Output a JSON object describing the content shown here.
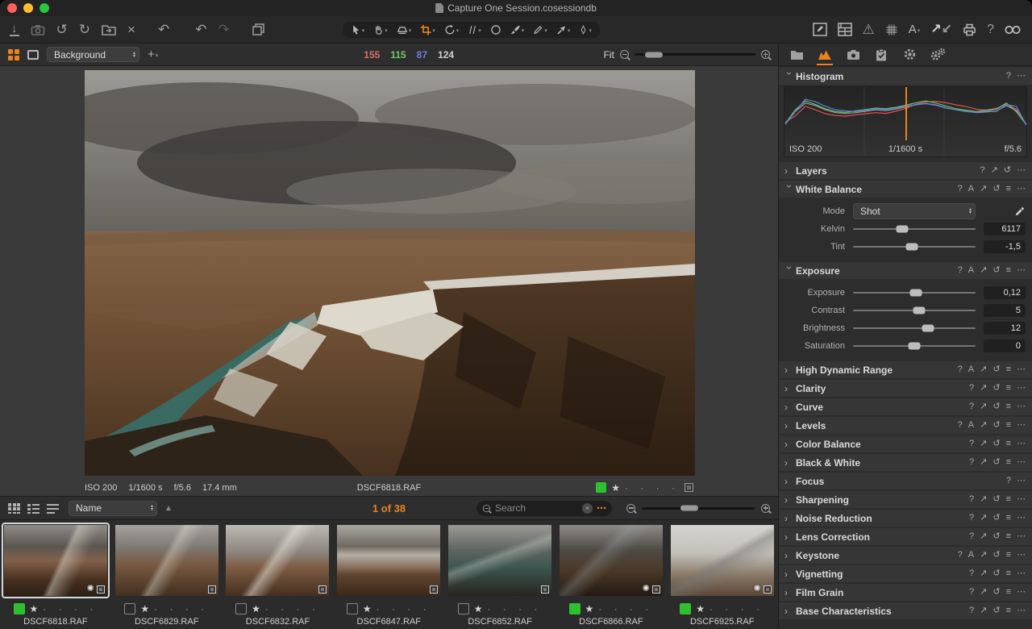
{
  "window": {
    "title": "Capture One Session.cosessiondb"
  },
  "colors": {
    "accent_orange": "#e8831d",
    "tag_green": "#2fc02f",
    "traffic_red": "#ff5f57",
    "traffic_yellow": "#febc2e",
    "traffic_green": "#28c840",
    "rgb_r": "#e06c6c",
    "rgb_g": "#6cc86c",
    "rgb_b": "#7a7ae8",
    "rgb_l": "#d0d0d0"
  },
  "icons": {
    "help": "?",
    "auto": "A",
    "copy": "↗",
    "reset": "↺",
    "presets": "≡",
    "more": "⋯",
    "chev_right": "›",
    "caret": "▾",
    "sort_asc": "▲",
    "star": "★",
    "dots": "· · · ·",
    "plus": "+",
    "close": "×",
    "undo": "↶",
    "redo": "↷",
    "rotate_ccw": "↺",
    "rotate_cw": "↻",
    "import": "↓",
    "warning": "⚠",
    "glasses": "OO",
    "annotation": "A",
    "export_up": "↗",
    "export_down": "↙",
    "gear_overlay": "✺"
  },
  "viewer_bar": {
    "layer_select": "Background",
    "rgb": {
      "r": "155",
      "g": "115",
      "b": "87",
      "l": "124"
    },
    "fit_label": "Fit"
  },
  "viewer_info": {
    "iso": "ISO 200",
    "shutter": "1/1600 s",
    "aperture": "f/5.6",
    "focal": "17.4 mm",
    "filename": "DSCF6818.RAF",
    "tag": "green",
    "rating": 1
  },
  "browser": {
    "sort_label": "Name",
    "count": "1 of 38",
    "search_placeholder": "Search",
    "more_label": "⋯"
  },
  "panels": {
    "histogram": {
      "title": "Histogram",
      "iso": "ISO 200",
      "shutter": "1/1600 s",
      "aperture": "f/5.6",
      "curves": {
        "r": [
          10,
          28,
          55,
          45,
          34,
          29,
          27,
          31,
          34,
          37,
          35,
          41,
          49,
          61,
          67,
          69,
          65,
          59,
          54,
          47,
          44,
          49,
          61,
          47,
          4
        ],
        "g": [
          6,
          45,
          70,
          60,
          48,
          40,
          38,
          42,
          46,
          50,
          48,
          52,
          58,
          65,
          70,
          64,
          56,
          48,
          44,
          40,
          44,
          46,
          64,
          40,
          3
        ],
        "b": [
          4,
          40,
          75,
          68,
          55,
          45,
          42,
          40,
          44,
          48,
          46,
          50,
          55,
          60,
          62,
          58,
          50,
          45,
          40,
          38,
          42,
          40,
          60,
          55,
          2
        ],
        "l": [
          5,
          40,
          64,
          57,
          45,
          37,
          35,
          37,
          41,
          45,
          43,
          47,
          53,
          59,
          63,
          59,
          51,
          45,
          41,
          37,
          39,
          41,
          57,
          43,
          3
        ]
      }
    },
    "layers": {
      "title": "Layers"
    },
    "white_balance": {
      "title": "White Balance",
      "mode_label": "Mode",
      "mode_value": "Shot",
      "kelvin_label": "Kelvin",
      "kelvin_value": "6117",
      "tint_label": "Tint",
      "tint_value": "-1,5"
    },
    "exposure": {
      "title": "Exposure",
      "sliders": [
        {
          "label": "Exposure",
          "value": "0,12"
        },
        {
          "label": "Contrast",
          "value": "5"
        },
        {
          "label": "Brightness",
          "value": "12"
        },
        {
          "label": "Saturation",
          "value": "0"
        }
      ]
    },
    "collapsed": [
      {
        "title": "High Dynamic Range",
        "auto": true
      },
      {
        "title": "Clarity",
        "auto": false
      },
      {
        "title": "Curve",
        "auto": false
      },
      {
        "title": "Levels",
        "auto": true
      },
      {
        "title": "Color Balance",
        "auto": false
      },
      {
        "title": "Black & White",
        "auto": false
      },
      {
        "title": "Focus",
        "auto": false,
        "minimal": true
      },
      {
        "title": "Sharpening",
        "auto": false
      },
      {
        "title": "Noise Reduction",
        "auto": false
      },
      {
        "title": "Lens Correction",
        "auto": false
      },
      {
        "title": "Keystone",
        "auto": true
      },
      {
        "title": "Vignetting",
        "auto": false
      },
      {
        "title": "Film Grain",
        "auto": false
      },
      {
        "title": "Base Characteristics",
        "auto": false
      }
    ]
  },
  "filmstrip": [
    {
      "filename": "DSCF6818.RAF",
      "tag": "green",
      "rating": 1,
      "selected": true,
      "has_adjustments": true
    },
    {
      "filename": "DSCF6829.RAF",
      "tag": "none",
      "rating": 1,
      "selected": false,
      "has_adjustments": false
    },
    {
      "filename": "DSCF6832.RAF",
      "tag": "none",
      "rating": 1,
      "selected": false,
      "has_adjustments": false
    },
    {
      "filename": "DSCF6847.RAF",
      "tag": "none",
      "rating": 1,
      "selected": false,
      "has_adjustments": false
    },
    {
      "filename": "DSCF6852.RAF",
      "tag": "none",
      "rating": 1,
      "selected": false,
      "has_adjustments": false
    },
    {
      "filename": "DSCF6866.RAF",
      "tag": "green",
      "rating": 1,
      "selected": false,
      "has_adjustments": true
    },
    {
      "filename": "DSCF6925.RAF",
      "tag": "green",
      "rating": 1,
      "selected": false,
      "has_adjustments": true
    }
  ]
}
